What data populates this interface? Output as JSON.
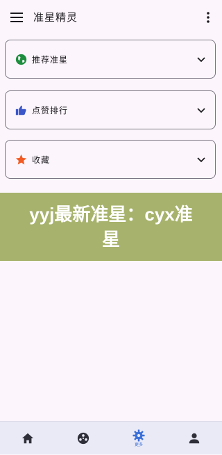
{
  "app": {
    "title": "准星精灵"
  },
  "cards": [
    {
      "label": "推荐准星",
      "icon": "globe-icon"
    },
    {
      "label": "点赞排行",
      "icon": "thumbs-up-icon"
    },
    {
      "label": "收藏",
      "icon": "star-icon"
    }
  ],
  "banner": {
    "text": "yyj最新准星：cyx准星"
  },
  "bottom_nav": [
    {
      "icon": "home-icon",
      "label": ""
    },
    {
      "icon": "target-icon",
      "label": ""
    },
    {
      "icon": "gear-icon",
      "label": "更多"
    },
    {
      "icon": "person-icon",
      "label": ""
    }
  ],
  "colors": {
    "banner_bg": "#a7b26c",
    "accent": "#3a6fd8",
    "star": "#f15a22",
    "globe": "#1e8e3e"
  }
}
